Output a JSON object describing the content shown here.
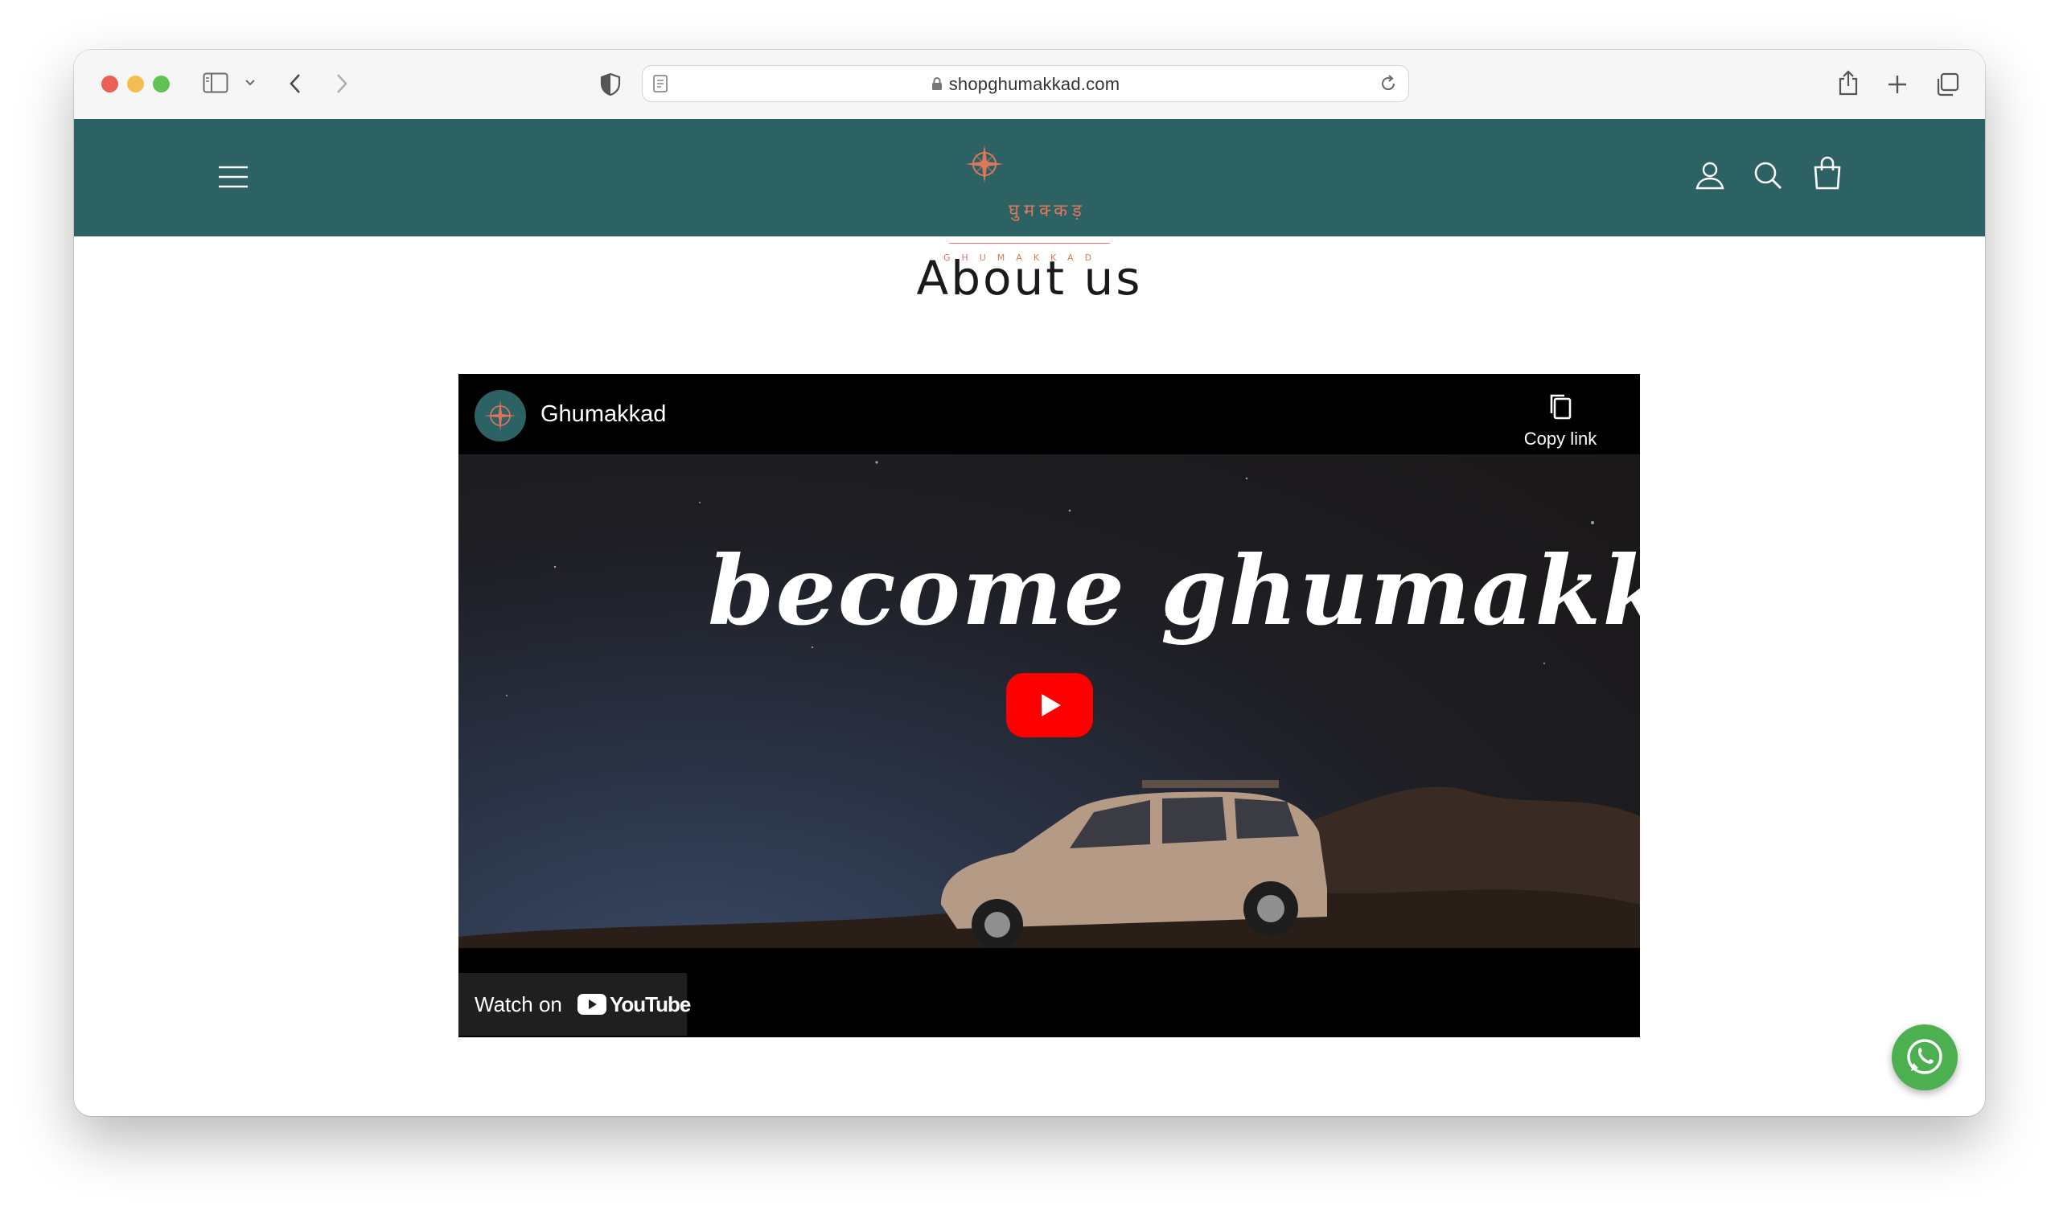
{
  "browser": {
    "url": "shopghumakkad.com"
  },
  "site": {
    "logo_devanagari": "घुमक्कड़",
    "logo_text": "GHUMAKKAD",
    "colors": {
      "header": "#2d6264",
      "accent": "#e0775a"
    },
    "icons": [
      "menu-icon",
      "account-icon",
      "search-icon",
      "cart-icon"
    ]
  },
  "page": {
    "title": "About us"
  },
  "video": {
    "channel": "Ghumakkad",
    "copy_link": "Copy link",
    "tagline": "become ghumakkad",
    "watch_on": "Watch on",
    "youtube": "YouTube"
  },
  "floating": {
    "whatsapp": "whatsapp-icon"
  }
}
